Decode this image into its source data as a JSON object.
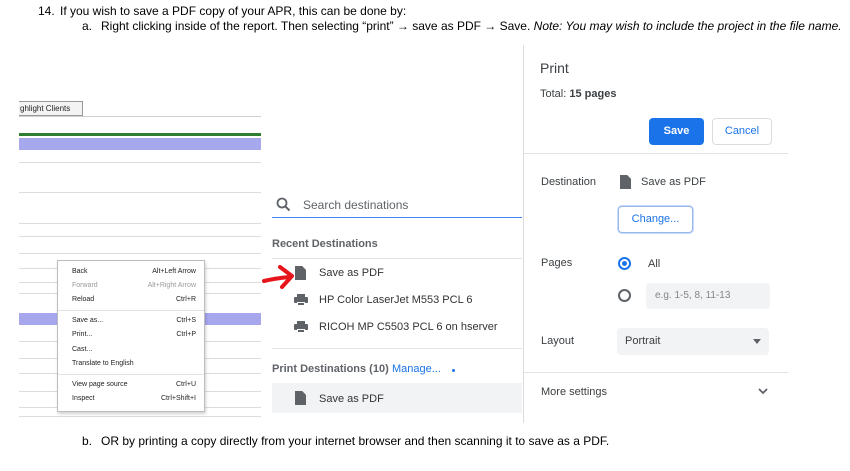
{
  "instructions": {
    "step14_number": "14.",
    "step14_text": "If you wish to save a PDF copy of your APR, this can be done by:",
    "step_a_letter": "a.",
    "step_a_text": "Right clicking inside of the report. Then selecting “print” → save as PDF → Save.",
    "step_a_note": "Note: You may wish to include the project in the file name.",
    "step_b_letter": "b.",
    "step_b_text": "OR by printing a copy directly from your internet browser and then scanning it to save as a PDF."
  },
  "report": {
    "tab_label": "ghlight Clients"
  },
  "context_menu": {
    "items": [
      {
        "label": "Back",
        "shortcut": "Alt+Left Arrow",
        "enabled": true
      },
      {
        "label": "Forward",
        "shortcut": "Alt+Right Arrow",
        "enabled": false
      },
      {
        "label": "Reload",
        "shortcut": "Ctrl+R",
        "enabled": true
      },
      {
        "label": "Save as...",
        "shortcut": "Ctrl+S",
        "enabled": true
      },
      {
        "label": "Print...",
        "shortcut": "Ctrl+P",
        "enabled": true
      },
      {
        "label": "Cast...",
        "shortcut": "",
        "enabled": true
      },
      {
        "label": "Translate to English",
        "shortcut": "",
        "enabled": true
      },
      {
        "label": "View page source",
        "shortcut": "Ctrl+U",
        "enabled": true
      },
      {
        "label": "Inspect",
        "shortcut": "Ctrl+Shift+I",
        "enabled": true
      }
    ]
  },
  "destinations": {
    "search_placeholder": "Search destinations",
    "recent_heading": "Recent Destinations",
    "recent": [
      {
        "label": "Save as PDF",
        "icon": "document-icon"
      },
      {
        "label": "HP Color LaserJet M553 PCL 6",
        "icon": "printer-icon"
      },
      {
        "label": "RICOH MP C5503 PCL 6 on hserver",
        "icon": "printer-icon"
      }
    ],
    "print_heading": "Print Destinations (10)",
    "manage_link": "Manage...",
    "print_list": [
      {
        "label": "Save as PDF",
        "icon": "document-icon"
      }
    ]
  },
  "print_dialog": {
    "title": "Print",
    "total_label": "Total:",
    "total_value": "15 pages",
    "save_button": "Save",
    "cancel_button": "Cancel",
    "destination_label": "Destination",
    "destination_value": "Save as PDF",
    "change_button": "Change...",
    "pages_label": "Pages",
    "pages_all": "All",
    "pages_custom_placeholder": "e.g. 1-5, 8, 11-13",
    "layout_label": "Layout",
    "layout_value": "Portrait",
    "more_settings": "More settings"
  },
  "colors": {
    "accent_blue": "#1a73e8",
    "annotation_red": "#e8141b",
    "report_purple": "#a7a7ee",
    "report_green": "#2e7d32"
  }
}
